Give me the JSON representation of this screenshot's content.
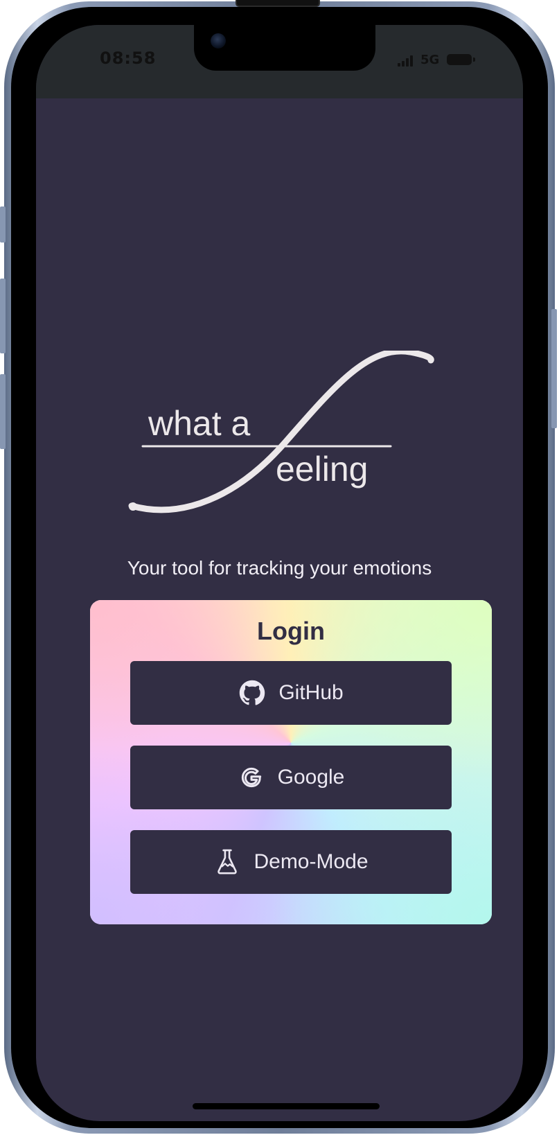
{
  "status_bar": {
    "time": "08:58",
    "network": "5G"
  },
  "logo": {
    "line1": "what a",
    "line2": "eeling"
  },
  "tagline": "Your tool for tracking your emotions",
  "login": {
    "title": "Login",
    "buttons": [
      {
        "label": "GitHub",
        "icon": "github-icon"
      },
      {
        "label": "Google",
        "icon": "google-icon"
      },
      {
        "label": "Demo-Mode",
        "icon": "flask-icon"
      }
    ]
  },
  "colors": {
    "background": "#322e44",
    "status_bar": "#262a2d",
    "text_light": "#ece8ea"
  }
}
